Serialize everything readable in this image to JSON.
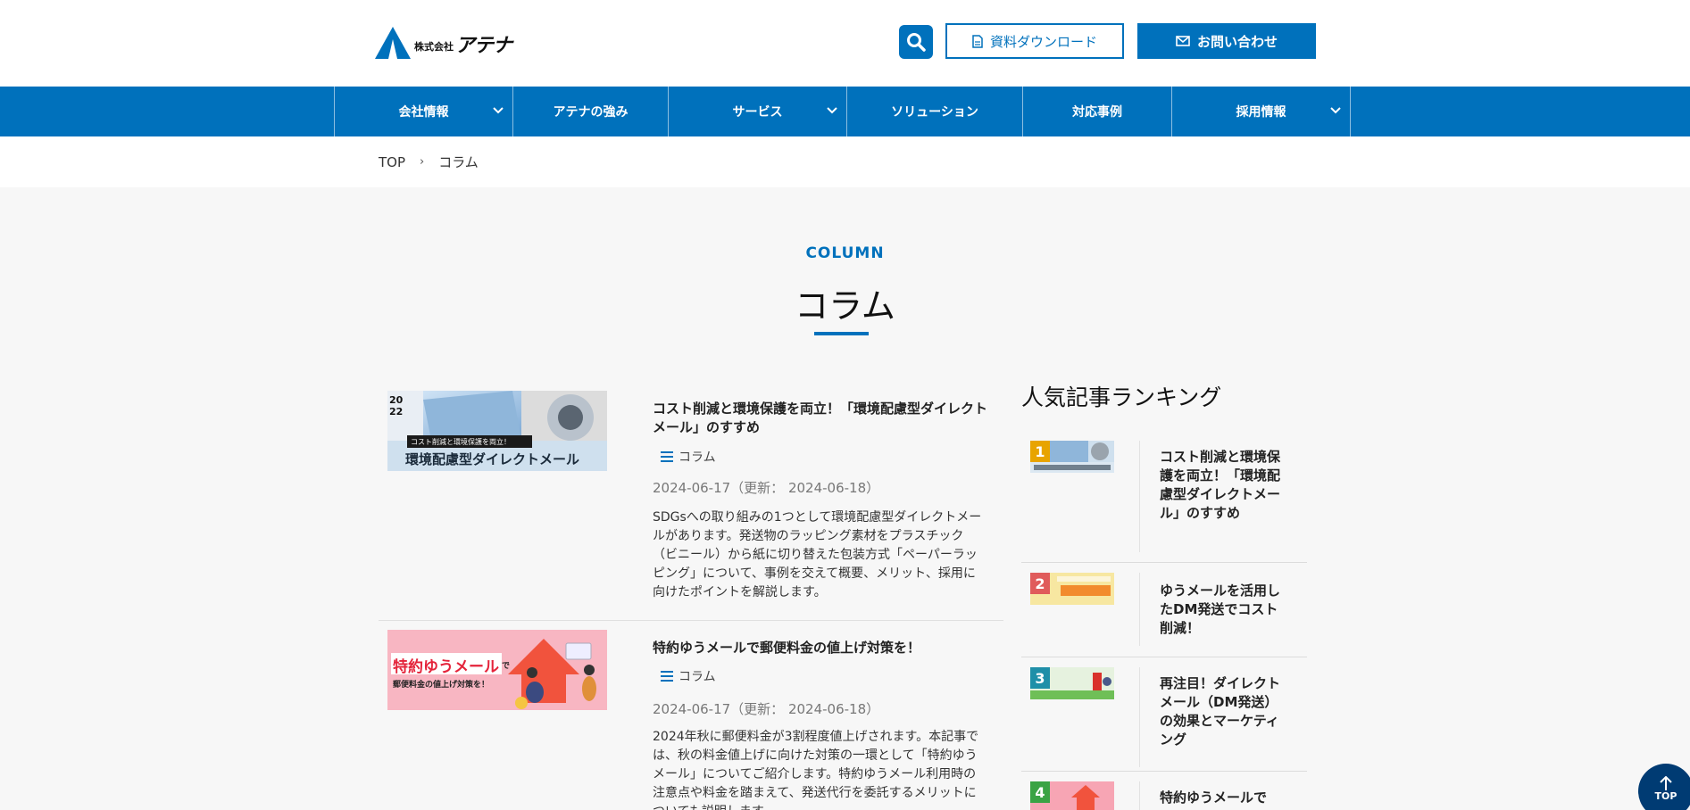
{
  "header": {
    "logo_small": "株式会社",
    "logo_big": "アテナ",
    "download_label": "資料ダウンロード",
    "contact_label": "お問い合わせ"
  },
  "nav": {
    "items": [
      {
        "label": "会社情報",
        "dropdown": true
      },
      {
        "label": "アテナの強み",
        "dropdown": false
      },
      {
        "label": "サービス",
        "dropdown": true
      },
      {
        "label": "ソリューション",
        "dropdown": false
      },
      {
        "label": "対応事例",
        "dropdown": false
      },
      {
        "label": "採用情報",
        "dropdown": true
      }
    ]
  },
  "breadcrumb": {
    "home": "TOP",
    "separator": "›",
    "current": "コラム"
  },
  "page": {
    "sub_title": "COLUMN",
    "title": "コラム"
  },
  "articles": [
    {
      "title": "コスト削減と環境保護を両立！「環境配慮型ダイレクトメール」のすすめ",
      "category": "コラム",
      "date": "2024-06-17（更新： 2024-06-18）",
      "excerpt": "SDGsへの取り組みの1つとして環境配慮型ダイレクトメールがあります。発送物のラッピング素材をプラスチック（ビニール）から紙に切り替えた包装方式「ペーパーラッピング」について、事例を交えて概要、メリット、採用に向けたポイントを解説します。",
      "thumb_year": "20 22",
      "thumb_caption": "コスト削減と環境保護を両立！",
      "thumb_title": "環境配慮型ダイレクトメール"
    },
    {
      "title": "特約ゆうメールで郵便料金の値上げ対策を！",
      "category": "コラム",
      "date": "2024-06-17（更新： 2024-06-18）",
      "excerpt": "2024年秋に郵便料金が3割程度値上げされます。本記事では、秋の料金値上げに向けた対策の一環として「特約ゆうメール」についてご紹介します。特約ゆうメール利用時の注意点や料金を踏まえて、発送代行を委託するメリットについても説明します。",
      "thumb_title": "特約ゆうメール",
      "thumb_de": "で",
      "thumb_caption": "郵便料金の値上げ対策を！"
    }
  ],
  "ranking": {
    "heading": "人気記事ランキング",
    "items": [
      {
        "rank": "1",
        "title": "コスト削減と環境保護を両立！「環境配慮型ダイレクトメール」のすすめ",
        "color": "#e8a400"
      },
      {
        "rank": "2",
        "title": "ゆうメールを活用したDM発送でコスト削減！",
        "color": "#e05b5b"
      },
      {
        "rank": "3",
        "title": "再注目！ダイレクトメール（DM発送）の効果とマーケティング",
        "color": "#1f8fa8"
      },
      {
        "rank": "4",
        "title": "特約ゆうメールで",
        "color": "#3aa344"
      }
    ]
  },
  "pagetop_label": "TOP",
  "colors": {
    "brand": "#0071bc",
    "pagetop": "#003b73"
  }
}
